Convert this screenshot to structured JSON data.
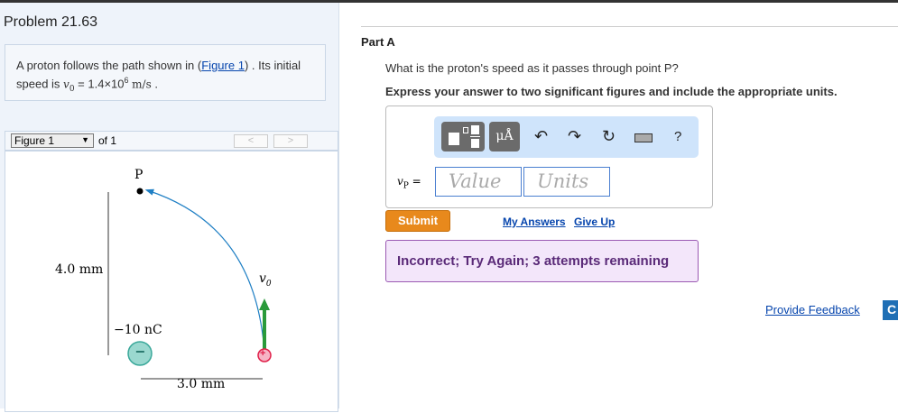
{
  "title": "Problem 21.63",
  "problem": {
    "text_before": "A proton follows the path shown in (",
    "figure_link": "Figure 1",
    "text_after": ") . Its initial speed is ",
    "var": "v",
    "sub": "0",
    "equals": " = 1.4×10",
    "exp": "6",
    "units": "m/s",
    "end": " ."
  },
  "figure_nav": {
    "selected": "Figure 1",
    "of": "of 1",
    "prev": "<",
    "next": ">"
  },
  "figure": {
    "point_label": "P",
    "height_label": "4.0 mm",
    "charge_label": "−10 nC",
    "width_label": "3.0 mm",
    "velocity_label": "v",
    "velocity_sub": "0",
    "neg_sign": "−",
    "pos_sign": "+"
  },
  "part": {
    "label": "Part A",
    "question": "What is the proton's speed as it passes through point P?",
    "instruction": "Express your answer to two significant figures and include the appropriate units."
  },
  "toolbar": {
    "units_button": "μÅ",
    "help": "?"
  },
  "answer": {
    "var": "v",
    "sub": "P",
    "equals": "=",
    "value_placeholder": "Value",
    "units_placeholder": "Units"
  },
  "actions": {
    "submit": "Submit",
    "my_answers": "My Answers",
    "give_up": "Give Up"
  },
  "feedback": "Incorrect; Try Again; 3 attempts remaining",
  "provide_feedback": "Provide Feedback",
  "continue": "C"
}
